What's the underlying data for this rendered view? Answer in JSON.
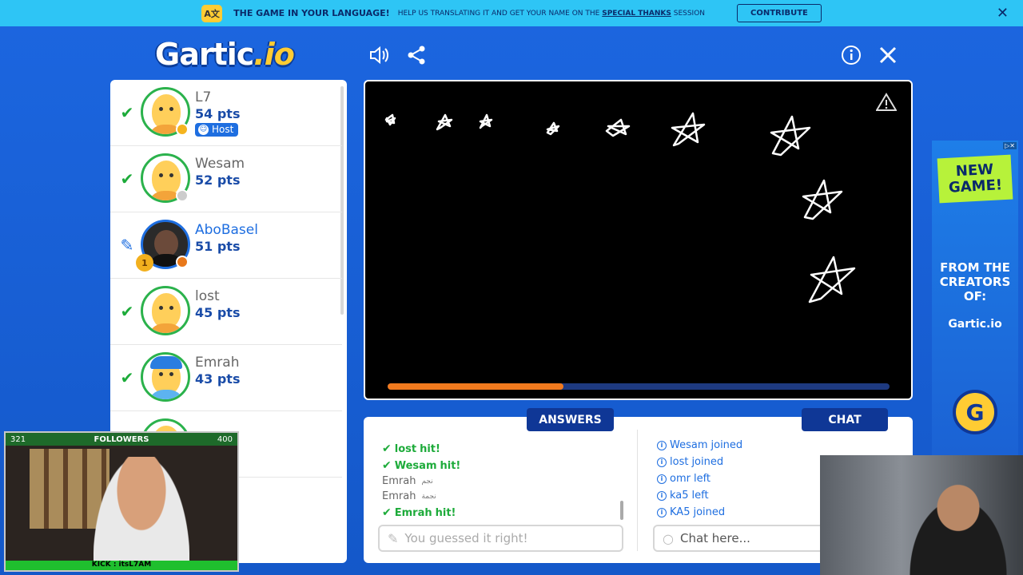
{
  "banner": {
    "title": "THE GAME IN YOUR LANGUAGE!",
    "help_pre": "HELP US TRANSLATING IT AND GET YOUR NAME ON THE",
    "help_link": "SPECIAL THANKS",
    "help_post": "SESSION",
    "contribute_label": "CONTRIBUTE",
    "icon_text": "A文"
  },
  "logo": {
    "main": "Gartic",
    "suffix": ".io"
  },
  "players": [
    {
      "name": "L7",
      "points": "54 pts",
      "mark": "✔",
      "host": true,
      "host_label": "Host",
      "status_color": "#f5b41e",
      "drawing": false
    },
    {
      "name": "Wesam",
      "points": "52 pts",
      "mark": "✔",
      "host": false,
      "status_color": "#cccccc",
      "drawing": false
    },
    {
      "name": "AboBasel",
      "points": "51 pts",
      "mark": "✎",
      "host": false,
      "status_color": "#e8781a",
      "drawing": true,
      "trophy": "1"
    },
    {
      "name": "lost",
      "points": "45 pts",
      "mark": "✔",
      "host": false,
      "drawing": false
    },
    {
      "name": "Emrah",
      "points": "43 pts",
      "mark": "✔",
      "host": false,
      "drawing": false
    }
  ],
  "timer": {
    "progress": 0.35
  },
  "tabs": {
    "answers": "ANSWERS",
    "chat": "CHAT"
  },
  "answers": [
    {
      "type": "hit",
      "user": "lost",
      "text": "hit!"
    },
    {
      "type": "hit",
      "user": "Wesam",
      "text": "hit!"
    },
    {
      "type": "guess",
      "user": "Emrah",
      "text": "نجم"
    },
    {
      "type": "guess",
      "user": "Emrah",
      "text": "نجمة"
    },
    {
      "type": "hit",
      "user": "Emrah",
      "text": "hit!"
    }
  ],
  "chat": [
    {
      "user": "Wesam",
      "text": "joined"
    },
    {
      "user": "lost",
      "text": "joined"
    },
    {
      "user": "omr",
      "text": "left"
    },
    {
      "user": "ka5",
      "text": "left"
    },
    {
      "user": "KA5",
      "text": "joined"
    }
  ],
  "answer_input": {
    "placeholder": "You guessed it right!"
  },
  "chat_input": {
    "placeholder": "Chat here..."
  },
  "ad": {
    "headline": "NEW GAME!",
    "sub": "FROM THE CREATORS OF:",
    "brand": "Gartic.io",
    "button": "G"
  },
  "webcam": {
    "count": "321",
    "label": "FOLLOWERS",
    "goal": "400",
    "handle": "KICK : itsL7AM"
  },
  "colors": {
    "accent": "#1e6ee0",
    "hit": "#1dab3a",
    "timer": "#f07a1e",
    "tab_bg": "#0f3796"
  }
}
